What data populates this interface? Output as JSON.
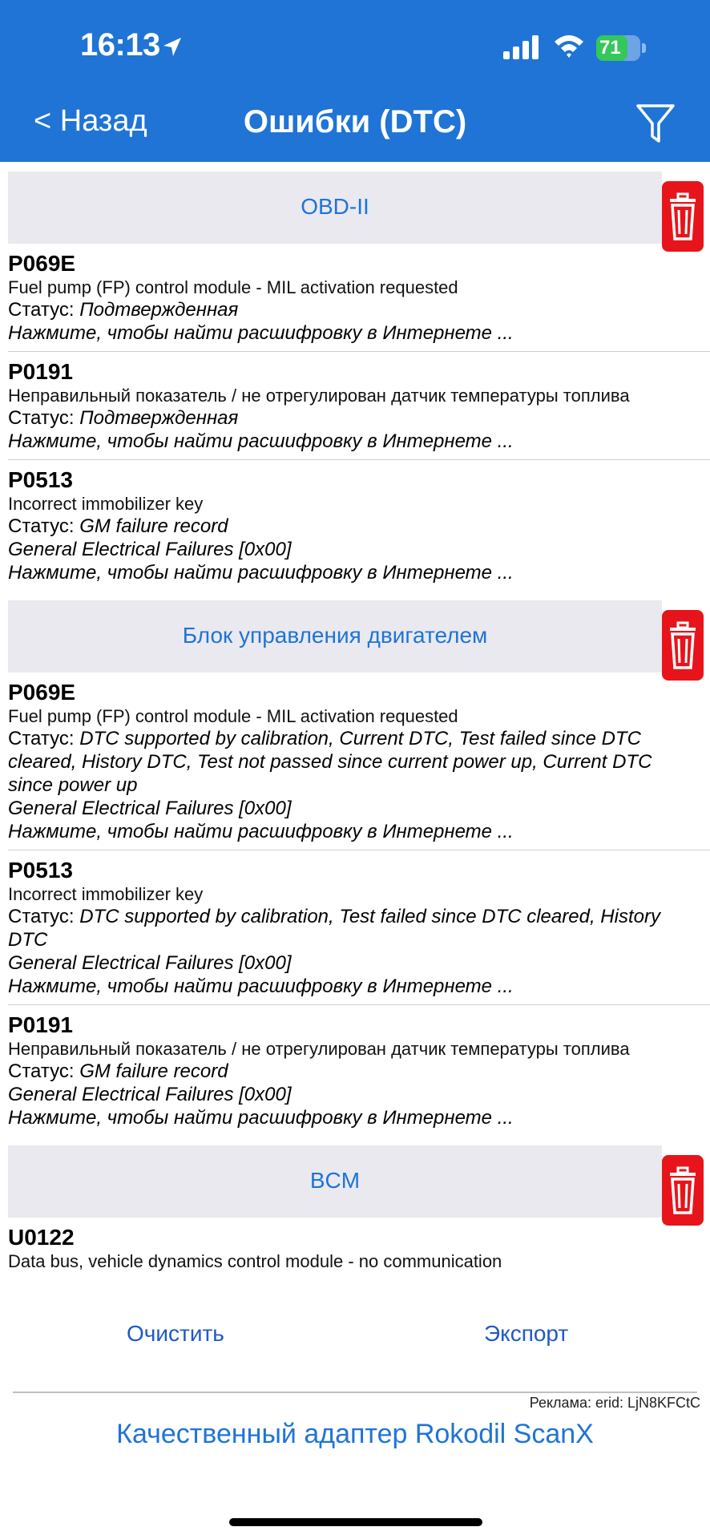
{
  "status_bar": {
    "time": "16:13",
    "battery": "71",
    "battery_level": 0.71
  },
  "nav": {
    "back_label": "< Назад",
    "title": "Ошибки (DTC)"
  },
  "sections": [
    {
      "title": "OBD-II",
      "items": [
        {
          "code": "P069E",
          "description": "Fuel pump (FP) control module - MIL activation requested",
          "status_prefix": "Статус: ",
          "status": "Подтвержденная",
          "extra": "",
          "hint": "Нажмите, чтобы найти расшифровку в Интернете ..."
        },
        {
          "code": "P0191",
          "description": "Неправильный показатель / не отрегулирован датчик температуры топлива",
          "status_prefix": "Статус: ",
          "status": "Подтвержденная",
          "extra": "",
          "hint": "Нажмите, чтобы найти расшифровку в Интернете ..."
        },
        {
          "code": "P0513",
          "description": "Incorrect immobilizer key",
          "status_prefix": "Статус: ",
          "status": "GM failure record",
          "extra": "General Electrical Failures [0x00]",
          "hint": "Нажмите, чтобы найти расшифровку в Интернете ..."
        }
      ]
    },
    {
      "title": "Блок управления двигателем",
      "items": [
        {
          "code": "P069E",
          "description": "Fuel pump (FP) control module - MIL activation requested",
          "status_prefix": "Статус: ",
          "status": "DTC supported by calibration, Current DTC, Test failed since DTC cleared, History DTC, Test not passed since current power up, Current DTC since power up",
          "extra": "General Electrical Failures [0x00]",
          "hint": "Нажмите, чтобы найти расшифровку в Интернете ..."
        },
        {
          "code": "P0513",
          "description": "Incorrect immobilizer key",
          "status_prefix": "Статус: ",
          "status": "DTC supported by calibration, Test failed since DTC cleared, History DTC",
          "extra": "General Electrical Failures [0x00]",
          "hint": "Нажмите, чтобы найти расшифровку в Интернете ..."
        },
        {
          "code": "P0191",
          "description": "Неправильный показатель / не отрегулирован датчик температуры топлива",
          "status_prefix": "Статус: ",
          "status": "GM failure record",
          "extra": "General Electrical Failures [0x00]",
          "hint": "Нажмите, чтобы найти расшифровку в Интернете ..."
        }
      ]
    },
    {
      "title": "BCM",
      "items": [
        {
          "code": "U0122",
          "description": "Data bus, vehicle dynamics control module - no communication",
          "status_prefix": "",
          "status": "",
          "extra": "",
          "hint": ""
        }
      ]
    }
  ],
  "bottom": {
    "clear_label": "Очистить",
    "export_label": "Экспорт",
    "ad_label": "Реклама: erid: LjN8KFCtC",
    "ad_text": "Качественный адаптер Rokodil ScanX"
  },
  "colors": {
    "accent": "#1f74d6",
    "danger": "#e8141b",
    "section_bg": "#e9e9ef",
    "battery": "#34c759"
  }
}
